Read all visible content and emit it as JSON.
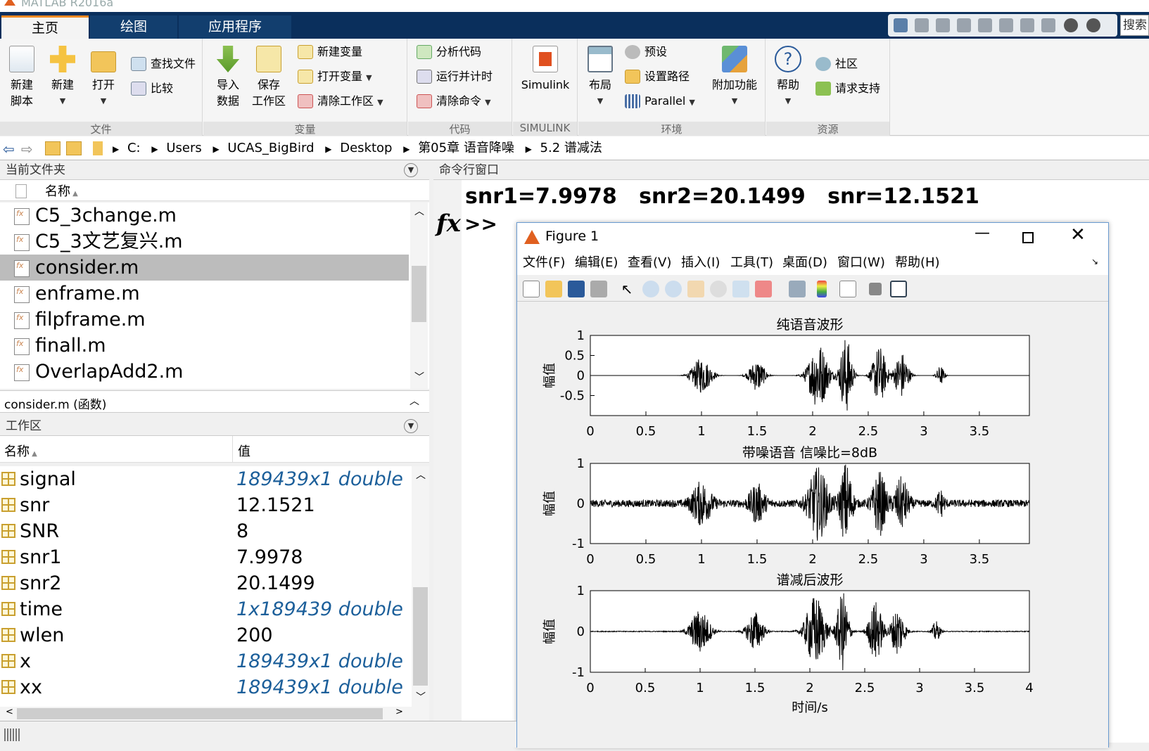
{
  "app": {
    "title": "MATLAB R2016a"
  },
  "tabs": [
    {
      "label": "主页",
      "active": true
    },
    {
      "label": "绘图"
    },
    {
      "label": "应用程序"
    }
  ],
  "search_label": "搜索",
  "ribbon": {
    "file": {
      "label": "文件",
      "new_script": [
        "新建",
        "脚本"
      ],
      "new": "新建",
      "open": "打开",
      "find_files": "查找文件",
      "compare": "比较"
    },
    "variable": {
      "label": "变量",
      "import": [
        "导入",
        "数据"
      ],
      "save": [
        "保存",
        "工作区"
      ],
      "new_var": "新建变量",
      "open_var": "打开变量",
      "clear_ws": "清除工作区"
    },
    "code": {
      "label": "代码",
      "analyze": "分析代码",
      "run_time": "运行并计时",
      "clear_cmd": "清除命令"
    },
    "simulink": {
      "label": "SIMULINK",
      "simulink": "Simulink"
    },
    "env": {
      "label": "环境",
      "layout": "布局",
      "prefs": "预设",
      "set_path": "设置路径",
      "parallel": "Parallel",
      "addons": "附加功能"
    },
    "resources": {
      "label": "资源",
      "help": "帮助",
      "community": "社区",
      "support": "请求支持"
    }
  },
  "address": [
    "C:",
    "Users",
    "UCAS_BigBird",
    "Desktop",
    "第05章 语音降噪",
    "5.2 谱减法"
  ],
  "current_folder": {
    "title": "当前文件夹",
    "col_name": "名称",
    "files": [
      "C5_3change.m",
      "C5_3文艺复兴.m",
      "consider.m",
      "enframe.m",
      "filpframe.m",
      "finall.m",
      "OverlapAdd2.m"
    ],
    "selected": "consider.m",
    "details": "consider.m  (函数)"
  },
  "workspace": {
    "title": "工作区",
    "col_name": "名称",
    "col_value": "值",
    "vars": [
      {
        "name": "signal",
        "value": "189439x1 double",
        "italic": true
      },
      {
        "name": "snr",
        "value": "12.1521",
        "italic": false
      },
      {
        "name": "SNR",
        "value": "8",
        "italic": false
      },
      {
        "name": "snr1",
        "value": "7.9978",
        "italic": false
      },
      {
        "name": "snr2",
        "value": "20.1499",
        "italic": false
      },
      {
        "name": "time",
        "value": "1x189439 double",
        "italic": true
      },
      {
        "name": "wlen",
        "value": "200",
        "italic": false
      },
      {
        "name": "x",
        "value": "189439x1 double",
        "italic": true
      },
      {
        "name": "xx",
        "value": "189439x1 double",
        "italic": true
      }
    ]
  },
  "command_window": {
    "title": "命令行窗口",
    "output": "snr1=7.9978   snr2=20.1499   snr=12.1521",
    "fx": "fx",
    "prompt": ">>"
  },
  "figure": {
    "title": "Figure 1",
    "menu": [
      "文件(F)",
      "编辑(E)",
      "查看(V)",
      "插入(I)",
      "工具(T)",
      "桌面(D)",
      "窗口(W)",
      "帮助(H)"
    ]
  },
  "chart_data": [
    {
      "type": "line",
      "title": "纯语音波形",
      "xlabel": "",
      "ylabel": "幅值",
      "xlim": [
        0,
        3.95
      ],
      "ylim": [
        -1,
        1
      ],
      "xticks": [
        "0",
        "0.5",
        "1",
        "1.5",
        "2",
        "2.5",
        "3",
        "3.5"
      ],
      "yticks": [
        "1",
        "0.5",
        "0",
        "-0.5"
      ],
      "noise": 0.0,
      "bursts": [
        [
          1.0,
          0.45,
          0.1
        ],
        [
          1.5,
          0.4,
          0.08
        ],
        [
          2.05,
          0.85,
          0.1
        ],
        [
          2.3,
          1.0,
          0.06
        ],
        [
          2.6,
          0.75,
          0.07
        ],
        [
          2.8,
          0.6,
          0.07
        ],
        [
          3.15,
          0.25,
          0.04
        ]
      ]
    },
    {
      "type": "line",
      "title": "带噪语音 信噪比=8dB",
      "xlabel": "",
      "ylabel": "幅值",
      "xlim": [
        0,
        3.95
      ],
      "ylim": [
        -1,
        1
      ],
      "xticks": [
        "0",
        "0.5",
        "1",
        "1.5",
        "2",
        "2.5",
        "3",
        "3.5"
      ],
      "yticks": [
        "1",
        "0",
        "-1"
      ],
      "noise": 0.09,
      "bursts": [
        [
          1.0,
          0.5,
          0.1
        ],
        [
          1.5,
          0.45,
          0.08
        ],
        [
          2.05,
          0.85,
          0.1
        ],
        [
          2.3,
          1.0,
          0.06
        ],
        [
          2.6,
          0.75,
          0.07
        ],
        [
          2.8,
          0.6,
          0.07
        ],
        [
          3.15,
          0.3,
          0.04
        ]
      ]
    },
    {
      "type": "line",
      "title": "谱减后波形",
      "xlabel": "时间/s",
      "ylabel": "幅值",
      "xlim": [
        0,
        4
      ],
      "ylim": [
        -1,
        1
      ],
      "xticks": [
        "0",
        "0.5",
        "1",
        "1.5",
        "2",
        "2.5",
        "3",
        "3.5",
        "4"
      ],
      "yticks": [
        "1",
        "0",
        "-1"
      ],
      "noise": 0.01,
      "bursts": [
        [
          1.0,
          0.55,
          0.1
        ],
        [
          1.5,
          0.5,
          0.08
        ],
        [
          2.05,
          0.9,
          0.1
        ],
        [
          2.3,
          1.0,
          0.06
        ],
        [
          2.6,
          0.75,
          0.07
        ],
        [
          2.8,
          0.6,
          0.07
        ],
        [
          3.15,
          0.25,
          0.04
        ]
      ]
    }
  ],
  "colors": {
    "tabstrip": "#0a2f5c",
    "accent": "#f08a24",
    "italic_value": "#1c5f9a"
  }
}
